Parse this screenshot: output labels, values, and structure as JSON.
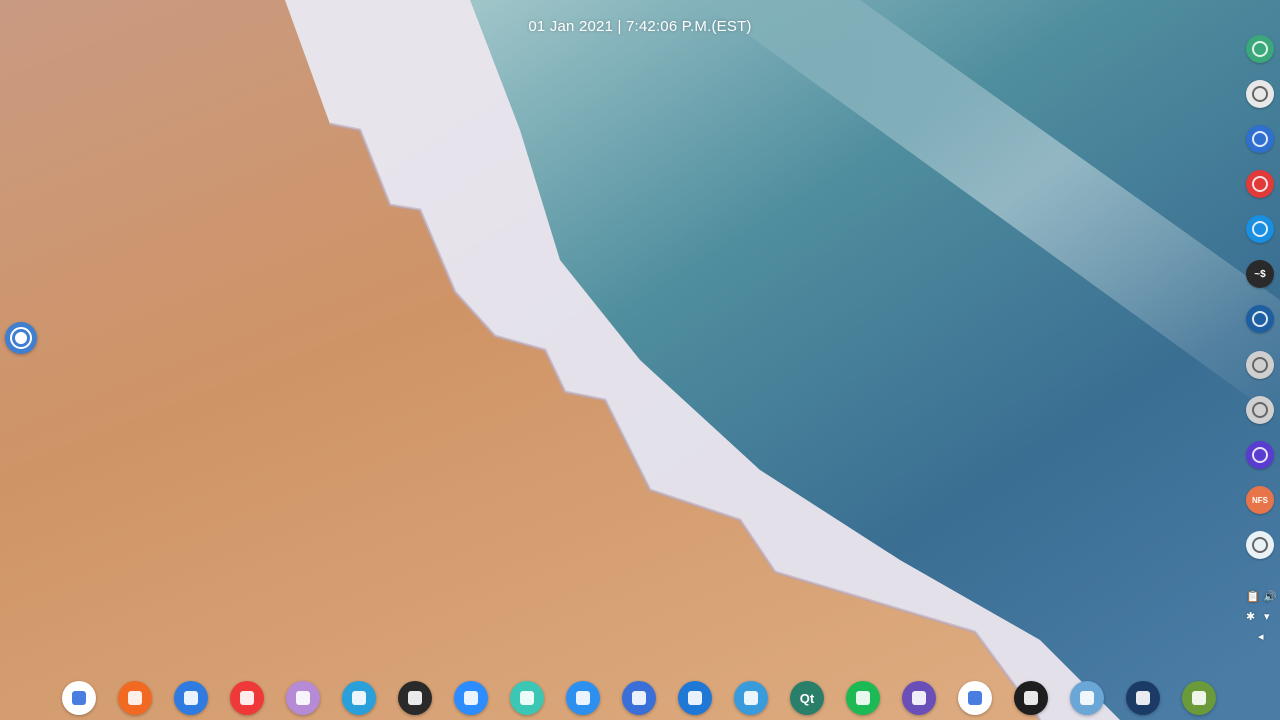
{
  "clock": {
    "text": "01 Jan 2021 | 7:42:06 P.M.(EST)"
  },
  "colors": {
    "sand": "#d4a07a",
    "foam": "#ece6ee",
    "sea": "#3f7e98",
    "deep_sea": "#2d5f86"
  },
  "launcher": {
    "icon": "launcher-icon"
  },
  "side_dock": [
    {
      "name": "system-monitor-icon",
      "color": "#3aa87a"
    },
    {
      "name": "settings-gear-icon",
      "color": "#e8e8e8"
    },
    {
      "name": "linux-penguin-icon",
      "color": "#2f6fd0"
    },
    {
      "name": "app-t-icon",
      "color": "#e03a3a"
    },
    {
      "name": "clock-icon",
      "color": "#1a8ee0"
    },
    {
      "name": "terminal-icon",
      "color": "#2a2a2a",
      "label": "~$"
    },
    {
      "name": "speedometer-icon",
      "color": "#1d5fa0"
    },
    {
      "name": "chat-bubble-icon",
      "color": "#cfcfcf"
    },
    {
      "name": "chrome-icon",
      "color": "#d0d0d0"
    },
    {
      "name": "audio-wave-icon",
      "color": "#5a3cd0"
    },
    {
      "name": "nfs-folder-icon",
      "color": "#e8744a",
      "label": "NFS"
    },
    {
      "name": "trash-icon",
      "color": "#e9f2f7"
    }
  ],
  "tray": {
    "clipboard_icon": "clipboard-icon",
    "volume_icon": "volume-icon",
    "bluetooth_icon": "bluetooth-icon",
    "wifi_icon": "wifi-icon",
    "collapse_icon": "chevron-left-icon"
  },
  "bottom_dock": [
    {
      "name": "google-assistant-icon",
      "color": "#ffffff"
    },
    {
      "name": "brave-icon",
      "color": "#f26a21"
    },
    {
      "name": "messages-icon",
      "color": "#2f7be0"
    },
    {
      "name": "vivaldi-icon",
      "color": "#ef3939"
    },
    {
      "name": "save-disk-icon",
      "color": "#b58bd6"
    },
    {
      "name": "telegram-icon",
      "color": "#2aa0db"
    },
    {
      "name": "whatsapp-icon",
      "color": "#2a2a2a"
    },
    {
      "name": "zoom-icon",
      "color": "#2d8cff"
    },
    {
      "name": "mail-icon",
      "color": "#3cc7b4"
    },
    {
      "name": "finder-icon",
      "color": "#2d8ff0"
    },
    {
      "name": "wps-office-icon",
      "color": "#3b6fd8"
    },
    {
      "name": "telescope-icon",
      "color": "#1f78d6"
    },
    {
      "name": "package-icon",
      "color": "#3a9bdc"
    },
    {
      "name": "qt-creator-icon",
      "color": "#2a7f6a",
      "label": "Qt"
    },
    {
      "name": "spotify-icon",
      "color": "#1db954"
    },
    {
      "name": "kdenlive-icon",
      "color": "#6b4fb8"
    },
    {
      "name": "media-player-icon",
      "color": "#ffffff"
    },
    {
      "name": "obs-studio-icon",
      "color": "#1e1e1e"
    },
    {
      "name": "diamond-icon",
      "color": "#6aa6d6"
    },
    {
      "name": "steam-icon",
      "color": "#1b3b66"
    },
    {
      "name": "minecraft-icon",
      "color": "#6a9a3a"
    }
  ]
}
